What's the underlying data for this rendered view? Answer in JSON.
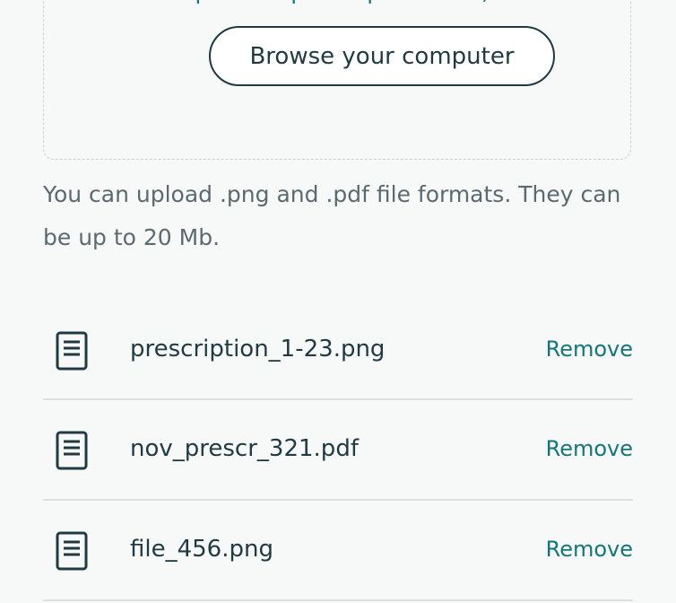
{
  "upload": {
    "drop_text": "Drop a new prescription here, or",
    "browse_label": "Browse your computer",
    "hint": "You can upload .png and .pdf file formats. They can be up to 20 Mb."
  },
  "files": [
    {
      "name": "prescription_1-23.png",
      "remove_label": "Remove",
      "icon": "document-icon"
    },
    {
      "name": "nov_prescr_321.pdf",
      "remove_label": "Remove",
      "icon": "document-icon"
    },
    {
      "name": "file_456.png",
      "remove_label": "Remove",
      "icon": "document-icon"
    }
  ],
  "colors": {
    "accent": "#13767a",
    "text": "#1f3a42",
    "muted": "#5b6a6f",
    "border": "#dcdfe0"
  }
}
